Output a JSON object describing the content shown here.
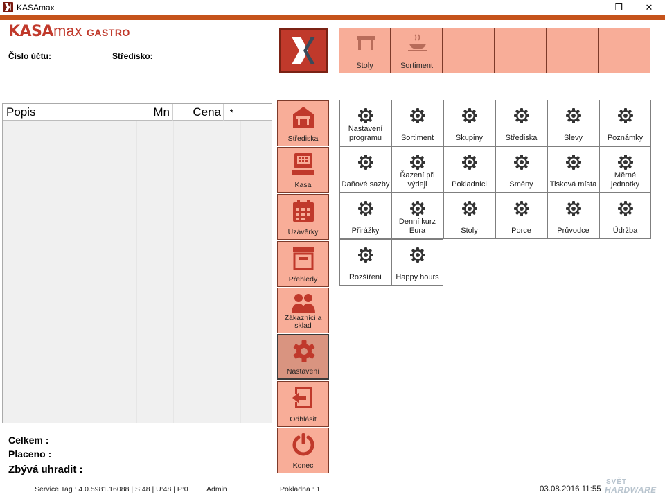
{
  "window": {
    "title": "KASAmax",
    "min": "—",
    "max": "❐",
    "close": "✕"
  },
  "logo": {
    "kasa": "KASA",
    "max": "max",
    "gastro": "GASTRO"
  },
  "header": {
    "cislo_uctu": "Číslo účtu:",
    "stredisko": "Středisko:"
  },
  "top_tiles": [
    {
      "label": "Stoly",
      "icon": "table-icon"
    },
    {
      "label": "Sortiment",
      "icon": "dish-icon"
    },
    {
      "label": ""
    },
    {
      "label": ""
    },
    {
      "label": ""
    },
    {
      "label": ""
    }
  ],
  "receipt": {
    "columns": [
      "Popis",
      "Mn",
      "Cena",
      "*"
    ],
    "rows": []
  },
  "totals": {
    "celkem": "Celkem  :",
    "placeno": "Placeno  :",
    "zbyva": "Zbývá uhradit :"
  },
  "nav": [
    {
      "label": "Střediska",
      "icon": "building-icon"
    },
    {
      "label": "Kasa",
      "icon": "register-icon"
    },
    {
      "label": "Uzávěrky",
      "icon": "calendar-icon"
    },
    {
      "label": "Přehledy",
      "icon": "archive-icon"
    },
    {
      "label": "Zákazníci a sklad",
      "icon": "people-icon"
    },
    {
      "label": "Nastavení",
      "icon": "gear-icon",
      "active": true
    },
    {
      "label": "Odhlásit",
      "icon": "logout-icon"
    },
    {
      "label": "Konec",
      "icon": "power-icon"
    }
  ],
  "settings": [
    "Nastavení programu",
    "Sortiment",
    "Skupiny",
    "Střediska",
    "Slevy",
    "Poznámky",
    "Daňové sazby",
    "Řazení při výdeji",
    "Pokladníci",
    "Směny",
    "Tisková místa",
    "Měrné jednotky",
    "Přirážky",
    "Denní kurz Eura",
    "Stoly",
    "Porce",
    "Průvodce",
    "Údržba",
    "Rozšíření",
    "Happy hours"
  ],
  "status": {
    "service_tag": "Service Tag : 4.0.5981.16088 | S:48 | U:48 | P:0",
    "user": "Admin",
    "pokladna": "Pokladna : 1",
    "datetime": "03.08.2016 11:55"
  },
  "watermark": {
    "top": "SVĚT",
    "bottom": "HARDWARE"
  },
  "colors": {
    "accent": "#c5531b",
    "tile": "#f8ad98",
    "tile_border": "#7d3a2a",
    "brand_red": "#c0392b"
  }
}
